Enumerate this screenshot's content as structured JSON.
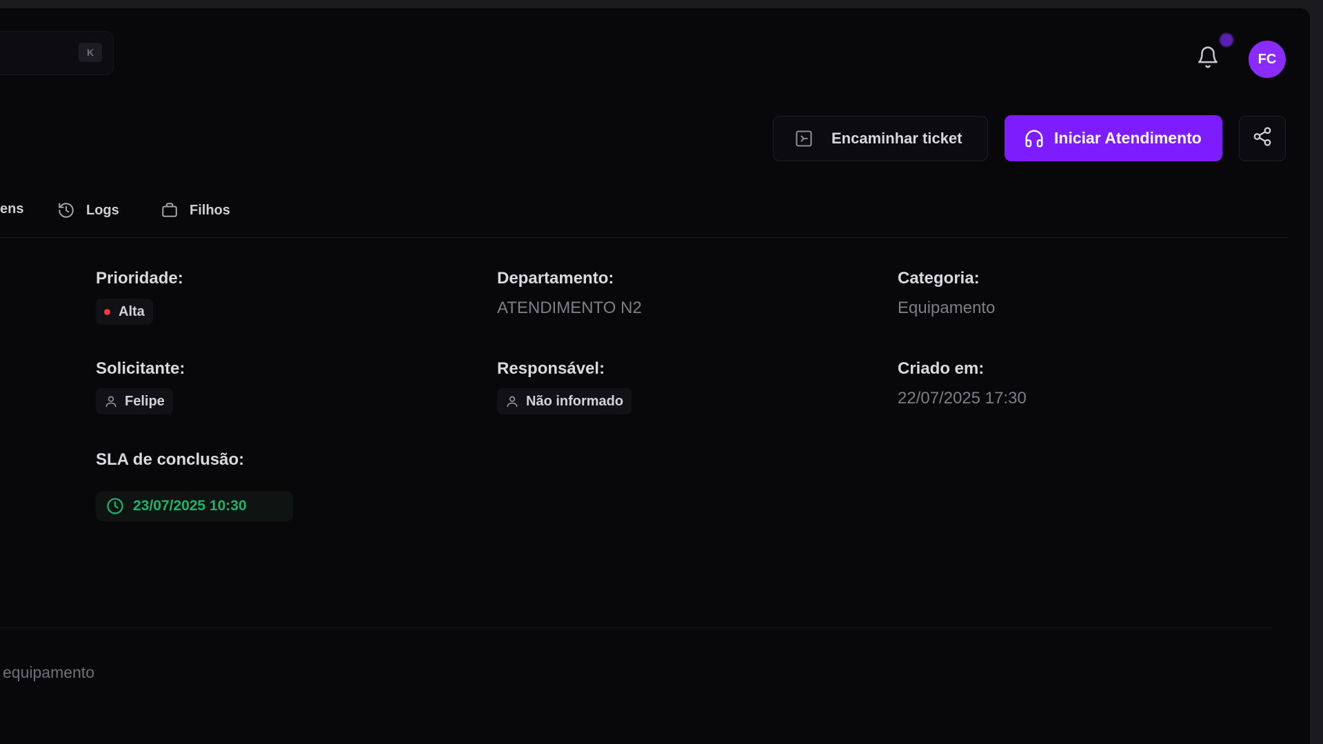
{
  "header": {
    "search_shortcut": "K",
    "avatar_initials": "FC"
  },
  "actions": {
    "forward_label": "Encaminhar ticket",
    "start_label": "Iniciar Atendimento"
  },
  "tabs": [
    {
      "label": "ens"
    },
    {
      "label": "Logs"
    },
    {
      "label": "Filhos"
    }
  ],
  "fields": {
    "priority": {
      "label": "Prioridade:",
      "value": "Alta"
    },
    "department": {
      "label": "Departamento:",
      "value": "ATENDIMENTO N2"
    },
    "category": {
      "label": "Categoria:",
      "value": "Equipamento"
    },
    "requester": {
      "label": "Solicitante:",
      "value": "Felipe"
    },
    "responsible": {
      "label": "Responsável:",
      "value": "Não informado"
    },
    "created": {
      "label": "Criado em:",
      "value": "22/07/2025 17:30"
    },
    "sla": {
      "label": "SLA de conclusão:",
      "value": "23/07/2025 10:30"
    }
  },
  "description": "equipamento",
  "colors": {
    "accent": "#7c1cff",
    "priority_high": "#ef3b3b",
    "sla_ok": "#1eb36c",
    "background": "#08080b"
  }
}
